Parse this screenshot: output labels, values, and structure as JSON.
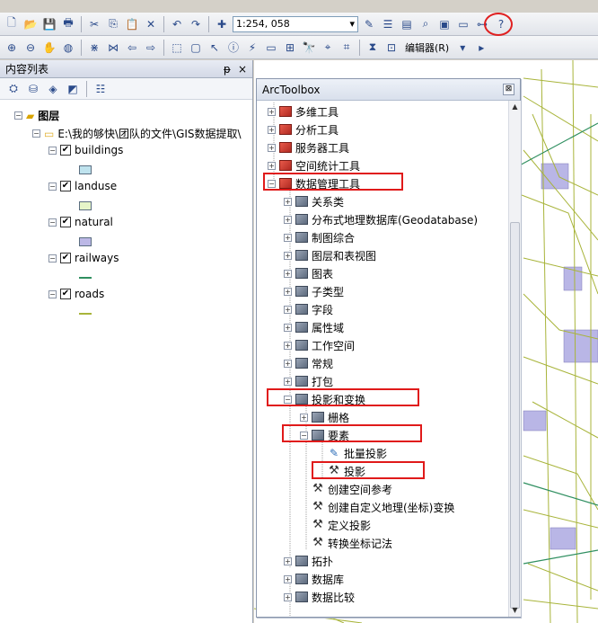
{
  "toolbar": {
    "scale_value": "1:254, 058",
    "editor_label": "编辑器(R)"
  },
  "toc": {
    "title": "内容列表",
    "pin": "ᵽ",
    "close": "×",
    "root": "图层",
    "path": "E:\\我的够快\\团队的文件\\GIS数据提取\\",
    "layers": [
      {
        "name": "buildings",
        "color": "#bfe3ee",
        "kind": "fill"
      },
      {
        "name": "landuse",
        "color": "#e6f5c8",
        "kind": "fill"
      },
      {
        "name": "natural",
        "color": "#bcb8e6",
        "kind": "fill"
      },
      {
        "name": "railways",
        "color": "#2f8f60",
        "kind": "line"
      },
      {
        "name": "roads",
        "color": "#a8b43a",
        "kind": "line"
      }
    ]
  },
  "arctoolbox": {
    "title": "ArcToolbox",
    "close": "⊠",
    "top_toolboxes": [
      "多维工具",
      "分析工具",
      "服务器工具",
      "空间统计工具",
      "数据管理工具"
    ],
    "data_mgmt_sets": [
      "关系类",
      "分布式地理数据库(Geodatabase)",
      "制图综合",
      "图层和表视图",
      "图表",
      "子类型",
      "字段",
      "属性域",
      "工作空间",
      "常规",
      "打包",
      "投影和变换"
    ],
    "projection_children": [
      "栅格",
      "要素"
    ],
    "feature_tools": [
      "批量投影",
      "投影"
    ],
    "projection_tools": [
      "创建空间参考",
      "创建自定义地理(坐标)变换",
      "定义投影",
      "转换坐标记法"
    ],
    "after_sets": [
      "拓扑",
      "数据库",
      "数据比较"
    ]
  }
}
